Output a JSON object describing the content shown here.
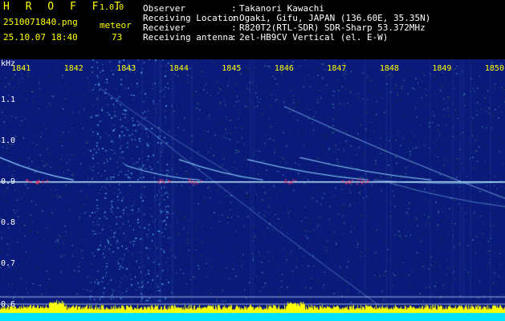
{
  "header": {
    "app_title": "H R O F F T",
    "version": "1.0.0",
    "filename": "2510071840.png",
    "datetime": "25.10.07 18:40",
    "meteor_label": "meteor",
    "meteor_count": "73",
    "info": [
      {
        "key": "Observer",
        "value": "Takanori Kawachi"
      },
      {
        "key": "Receiving Location",
        "value": "Ogaki, Gifu, JAPAN (136.60E, 35.35N)"
      },
      {
        "key": "Receiver",
        "value": "R820T2(RTL-SDR) SDR-Sharp 53.372MHz"
      },
      {
        "key": "Receiving antenna",
        "value": "2el-HB9CV Vertical (el. E-W)"
      }
    ]
  },
  "spectrogram": {
    "y_unit": "kHz",
    "y_ticks": [
      "1.1",
      "1.0",
      "0.9",
      "0.8",
      "0.7",
      "0.6"
    ],
    "y_values": [
      1.1,
      1.0,
      0.9,
      0.8,
      0.7,
      0.6
    ],
    "y_range": [
      0.56,
      1.2
    ],
    "x_ticks": [
      "1841",
      "1842",
      "1843",
      "1844",
      "1845",
      "1846",
      "1847",
      "1848",
      "1849",
      "1850"
    ],
    "x_values": [
      1841,
      1842,
      1843,
      1844,
      1845,
      1846,
      1847,
      1848,
      1849,
      1850
    ],
    "x_range": [
      1840.6,
      1850.2
    ],
    "carrier_khz": 0.9,
    "colors": {
      "background": "#0a1a7a",
      "trace": "#8fd8ff",
      "carrier": "#c0f0ff",
      "hot": "#ff3060",
      "bar": "#ffff00",
      "baseline": "#00e0ff",
      "label": "#ffff00"
    }
  }
}
